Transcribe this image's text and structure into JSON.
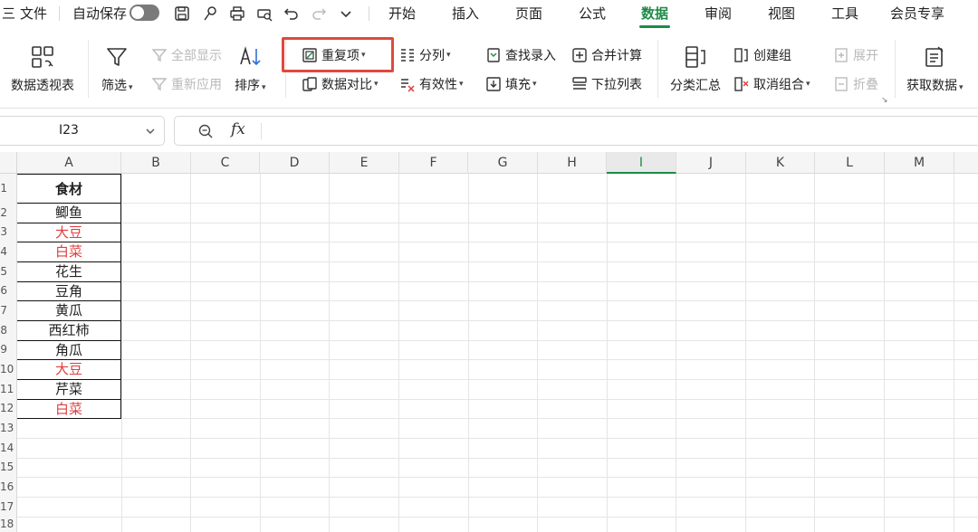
{
  "menubar": {
    "hamburger": "三",
    "file": "文件",
    "autosave": "自动保存",
    "tabs": [
      "开始",
      "插入",
      "页面",
      "公式",
      "数据",
      "审阅",
      "视图",
      "工具",
      "会员专享"
    ],
    "active_tab": "数据"
  },
  "ribbon": {
    "pivot": "数据透视表",
    "filter": "筛选",
    "show_all": "全部显示",
    "reapply": "重新应用",
    "sort": "排序",
    "duplicates": "重复项",
    "compare": "数据对比",
    "split": "分列",
    "validity": "有效性",
    "lookup_entry": "查找录入",
    "fill": "填充",
    "merge_calc": "合并计算",
    "dropdown_list": "下拉列表",
    "subtotal": "分类汇总",
    "create_group": "创建组",
    "ungroup": "取消组合",
    "expand": "展开",
    "collapse": "折叠",
    "get_data": "获取数据"
  },
  "formula_bar": {
    "name_box": "I23",
    "fx": "fx",
    "value": ""
  },
  "sheet": {
    "columns": [
      "A",
      "B",
      "C",
      "D",
      "E",
      "F",
      "G",
      "H",
      "I",
      "J",
      "K",
      "L",
      "M"
    ],
    "selected_column": "I",
    "row_numbers": [
      "1",
      "2",
      "3",
      "4",
      "5",
      "6",
      "7",
      "8",
      "9",
      "10",
      "11",
      "12",
      "13",
      "14",
      "15",
      "16",
      "17",
      "18"
    ],
    "header": "食材",
    "column_a": [
      {
        "text": "鲫鱼",
        "duplicate": false
      },
      {
        "text": "大豆",
        "duplicate": true
      },
      {
        "text": "白菜",
        "duplicate": true
      },
      {
        "text": "花生",
        "duplicate": false
      },
      {
        "text": "豆角",
        "duplicate": false
      },
      {
        "text": "黄瓜",
        "duplicate": false
      },
      {
        "text": "西红柿",
        "duplicate": false
      },
      {
        "text": "角瓜",
        "duplicate": false
      },
      {
        "text": "大豆",
        "duplicate": true
      },
      {
        "text": "芹菜",
        "duplicate": false
      },
      {
        "text": "白菜",
        "duplicate": true
      }
    ]
  },
  "colors": {
    "accent": "#1f8a47",
    "duplicate_text": "#e03c3c",
    "highlight_box": "#e0483e"
  }
}
